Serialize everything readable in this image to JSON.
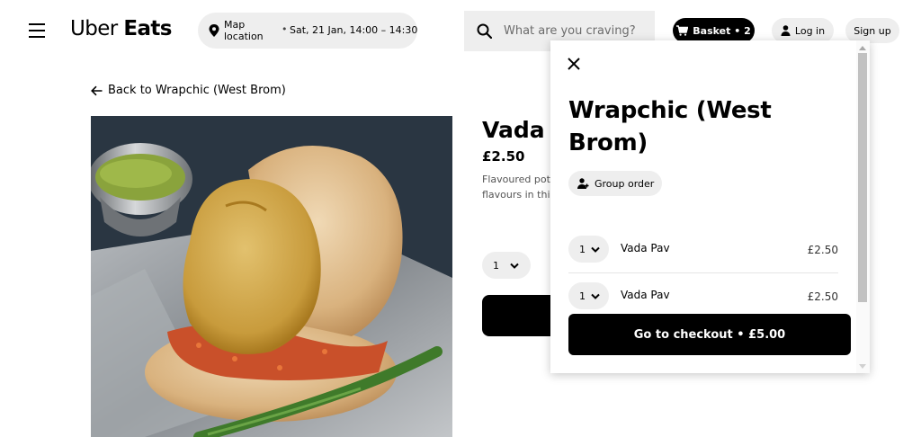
{
  "header": {
    "logo_uber": "Uber",
    "logo_eats": "Eats",
    "location_label": "Map location",
    "location_dot": "•",
    "delivery_time": "Sat, 21 Jan, 14:00 – 14:30",
    "search_placeholder": "What are you craving?",
    "basket_label": "Basket • 2",
    "login_label": "Log in",
    "signup_label": "Sign up"
  },
  "main": {
    "back_link": "Back to Wrapchic (West Brom)",
    "product_title": "Vada Pav",
    "product_price": "£2.50",
    "product_description": "Flavoured potato in a bap with a flavours in this",
    "quantity": "1"
  },
  "drawer": {
    "title": "Wrapchic (West Brom)",
    "group_order_label": "Group order",
    "items": [
      {
        "qty": "1",
        "name": "Vada Pav",
        "price": "£2.50"
      },
      {
        "qty": "1",
        "name": "Vada Pav",
        "price": "£2.50"
      }
    ],
    "checkout_label": "Go to checkout • £5.00"
  },
  "colors": {
    "primary": "#000000",
    "pill_bg": "#eeeeee",
    "text_secondary": "#545454"
  },
  "icons": [
    "menu-icon",
    "location-pin-icon",
    "search-icon",
    "basket-icon",
    "person-icon",
    "arrow-left-icon",
    "chevron-down-icon",
    "close-icon",
    "add-person-icon"
  ]
}
